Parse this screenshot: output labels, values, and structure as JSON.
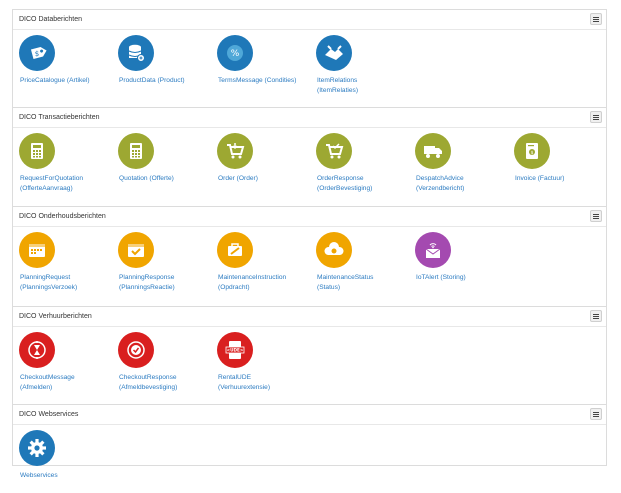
{
  "colors": {
    "blue": "#1f78b8",
    "olive": "#9da832",
    "orange": "#f0a500",
    "purple": "#a44ab0",
    "red": "#d91f1f",
    "link": "#2b7bc1"
  },
  "sections": [
    {
      "title": "DICO Databerichten",
      "items": [
        {
          "icon": "price-tag-icon",
          "color": "#1f78b8",
          "line1": "PriceCatalogue (Artikel)",
          "line2": ""
        },
        {
          "icon": "database-icon",
          "color": "#1f78b8",
          "line1": "ProductData (Product)",
          "line2": ""
        },
        {
          "icon": "percent-badge-icon",
          "color": "#1f78b8",
          "line1": "TermsMessage (Condities)",
          "line2": ""
        },
        {
          "icon": "handshake-icon",
          "color": "#1f78b8",
          "line1": "ItemRelations",
          "line2": "(ItemRelaties)"
        }
      ]
    },
    {
      "title": "DICO Transactieberichten",
      "items": [
        {
          "icon": "calculator-icon",
          "color": "#9da832",
          "line1": "RequestForQuotation",
          "line2": "(OfferteAanvraag)"
        },
        {
          "icon": "calculator-icon",
          "color": "#9da832",
          "line1": "Quotation (Offerte)",
          "line2": ""
        },
        {
          "icon": "cart-icon",
          "color": "#9da832",
          "line1": "Order (Order)",
          "line2": ""
        },
        {
          "icon": "cart-check-icon",
          "color": "#9da832",
          "line1": "OrderResponse",
          "line2": "(OrderBevestiging)"
        },
        {
          "icon": "truck-icon",
          "color": "#9da832",
          "line1": "DespatchAdvice",
          "line2": "(Verzendbericht)"
        },
        {
          "icon": "invoice-icon",
          "color": "#9da832",
          "line1": "Invoice (Factuur)",
          "line2": ""
        }
      ]
    },
    {
      "title": "DICO Onderhoudsberichten",
      "items": [
        {
          "icon": "calendar-icon",
          "color": "#f0a500",
          "line1": "PlanningRequest",
          "line2": "(PlanningsVerzoek)"
        },
        {
          "icon": "calendar-check-icon",
          "color": "#f0a500",
          "line1": "PlanningResponse",
          "line2": "(PlanningsReactie)"
        },
        {
          "icon": "tools-icon",
          "color": "#f0a500",
          "line1": "MaintenanceInstruction",
          "line2": "(Opdracht)"
        },
        {
          "icon": "cloud-status-icon",
          "color": "#f0a500",
          "line1": "MaintenanceStatus",
          "line2": "(Status)"
        },
        {
          "icon": "iot-mail-icon",
          "color": "#a44ab0",
          "line1": "IoTAlert (Storing)",
          "line2": ""
        }
      ]
    },
    {
      "title": "DICO Verhuurberichten",
      "items": [
        {
          "icon": "hourglass-icon",
          "color": "#d91f1f",
          "line1": "CheckoutMessage",
          "line2": "(Afmelden)"
        },
        {
          "icon": "check-circle-icon",
          "color": "#d91f1f",
          "line1": "CheckoutResponse",
          "line2": "(Afmeldbevestiging)"
        },
        {
          "icon": "ude-file-icon",
          "color": "#d91f1f",
          "line1": "RentalUDE",
          "line2": "(Verhuurextensie)"
        }
      ]
    },
    {
      "title": "DICO Webservices",
      "items": [
        {
          "icon": "gear-icon",
          "color": "#1f78b8",
          "line1": "Webservices",
          "line2": ""
        }
      ]
    }
  ],
  "ude_text": "<UDE>"
}
